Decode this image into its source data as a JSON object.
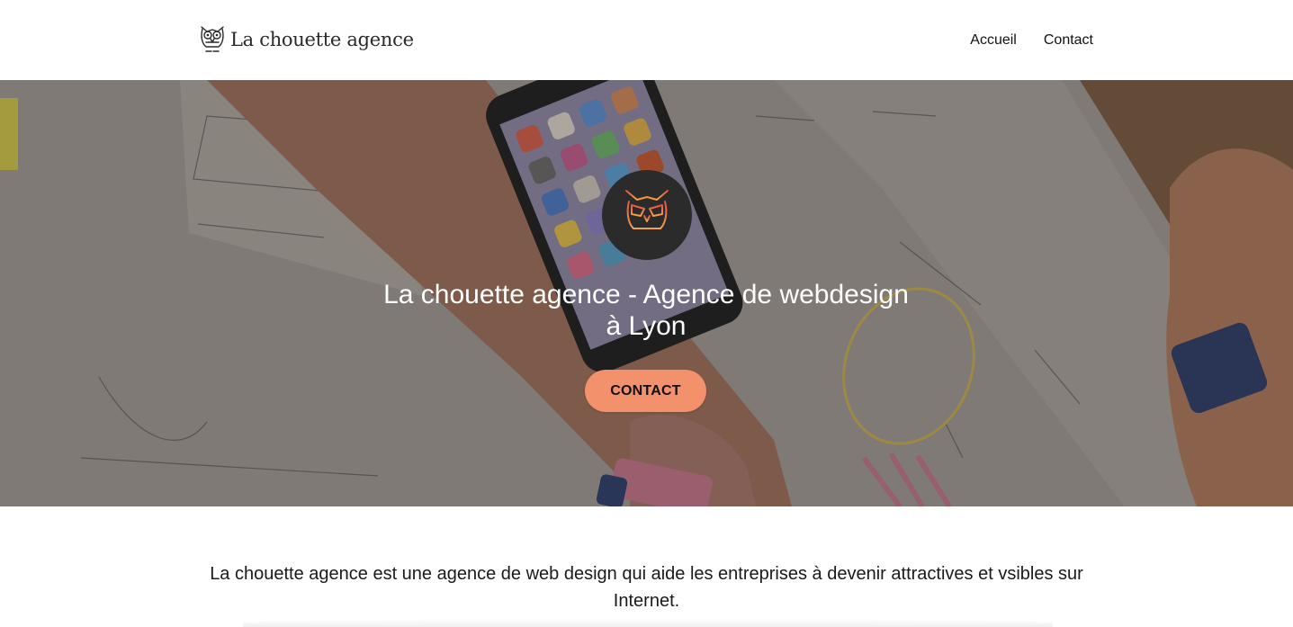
{
  "header": {
    "brand_name": "La chouette agence",
    "logo_icon": "owl-icon",
    "nav": [
      {
        "label": "Accueil"
      },
      {
        "label": "Contact"
      }
    ]
  },
  "hero": {
    "title": "La chouette agence - Agence de webdesign à Lyon",
    "badge_icon": "owl-icon",
    "cta_label": "CONTACT",
    "cta_color": "#f2916c",
    "background": "photo of hands sketching wireframes on paper next to a smartphone"
  },
  "intro": {
    "text": "La chouette agence est une agence de web design qui aide les entreprises à devenir attractives et vsibles sur Internet."
  }
}
